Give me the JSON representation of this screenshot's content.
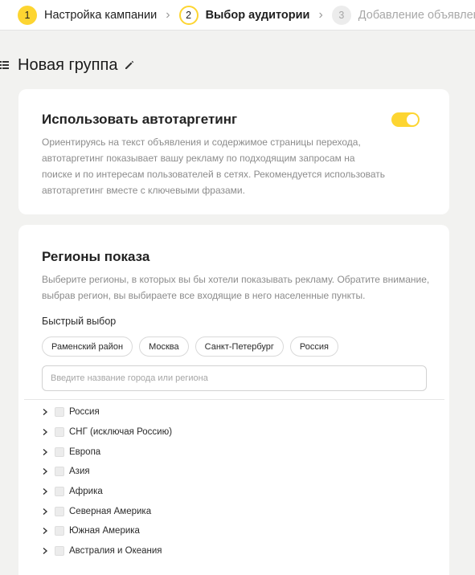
{
  "stepper": {
    "steps": [
      {
        "number": "1",
        "label": "Настройка кампании"
      },
      {
        "number": "2",
        "label": "Выбор аудитории"
      },
      {
        "number": "3",
        "label": "Добавление объявлений"
      }
    ]
  },
  "group": {
    "title": "Новая группа",
    "icons": {
      "list": "list-icon",
      "edit": "pencil-icon"
    }
  },
  "autotargeting": {
    "title": "Использовать автотаргетинг",
    "description": "Ориентируясь на текст объявления и содержимое страницы перехода, автотаргетинг показывает вашу рекламу по подходящим запросам на поиске и по интересам пользователей в сетях. Рекомендуется использовать автотаргетинг вместе с ключевыми фразами.",
    "enabled": true
  },
  "regions": {
    "title": "Регионы показа",
    "description": "Выберите регионы, в которых вы бы хотели показывать рекламу. Обратите внимание, выбрав регион, вы выбираете все входящие в него населенные пункты.",
    "quick_label": "Быстрый выбор",
    "quick_chips": [
      "Раменский район",
      "Москва",
      "Санкт-Петербург",
      "Россия"
    ],
    "search": {
      "value": "",
      "placeholder": "Введите название города или региона"
    },
    "tree": [
      {
        "label": "Россия",
        "checked": false
      },
      {
        "label": "СНГ (исключая Россию)",
        "checked": false
      },
      {
        "label": "Европа",
        "checked": false
      },
      {
        "label": "Азия",
        "checked": false
      },
      {
        "label": "Африка",
        "checked": false
      },
      {
        "label": "Северная Америка",
        "checked": false
      },
      {
        "label": "Южная Америка",
        "checked": false
      },
      {
        "label": "Австралия и Океания",
        "checked": false
      }
    ]
  },
  "colors": {
    "accent": "#fdd531",
    "background": "#f2f2f0",
    "card": "#ffffff",
    "muted_text": "#8c8c8c"
  }
}
